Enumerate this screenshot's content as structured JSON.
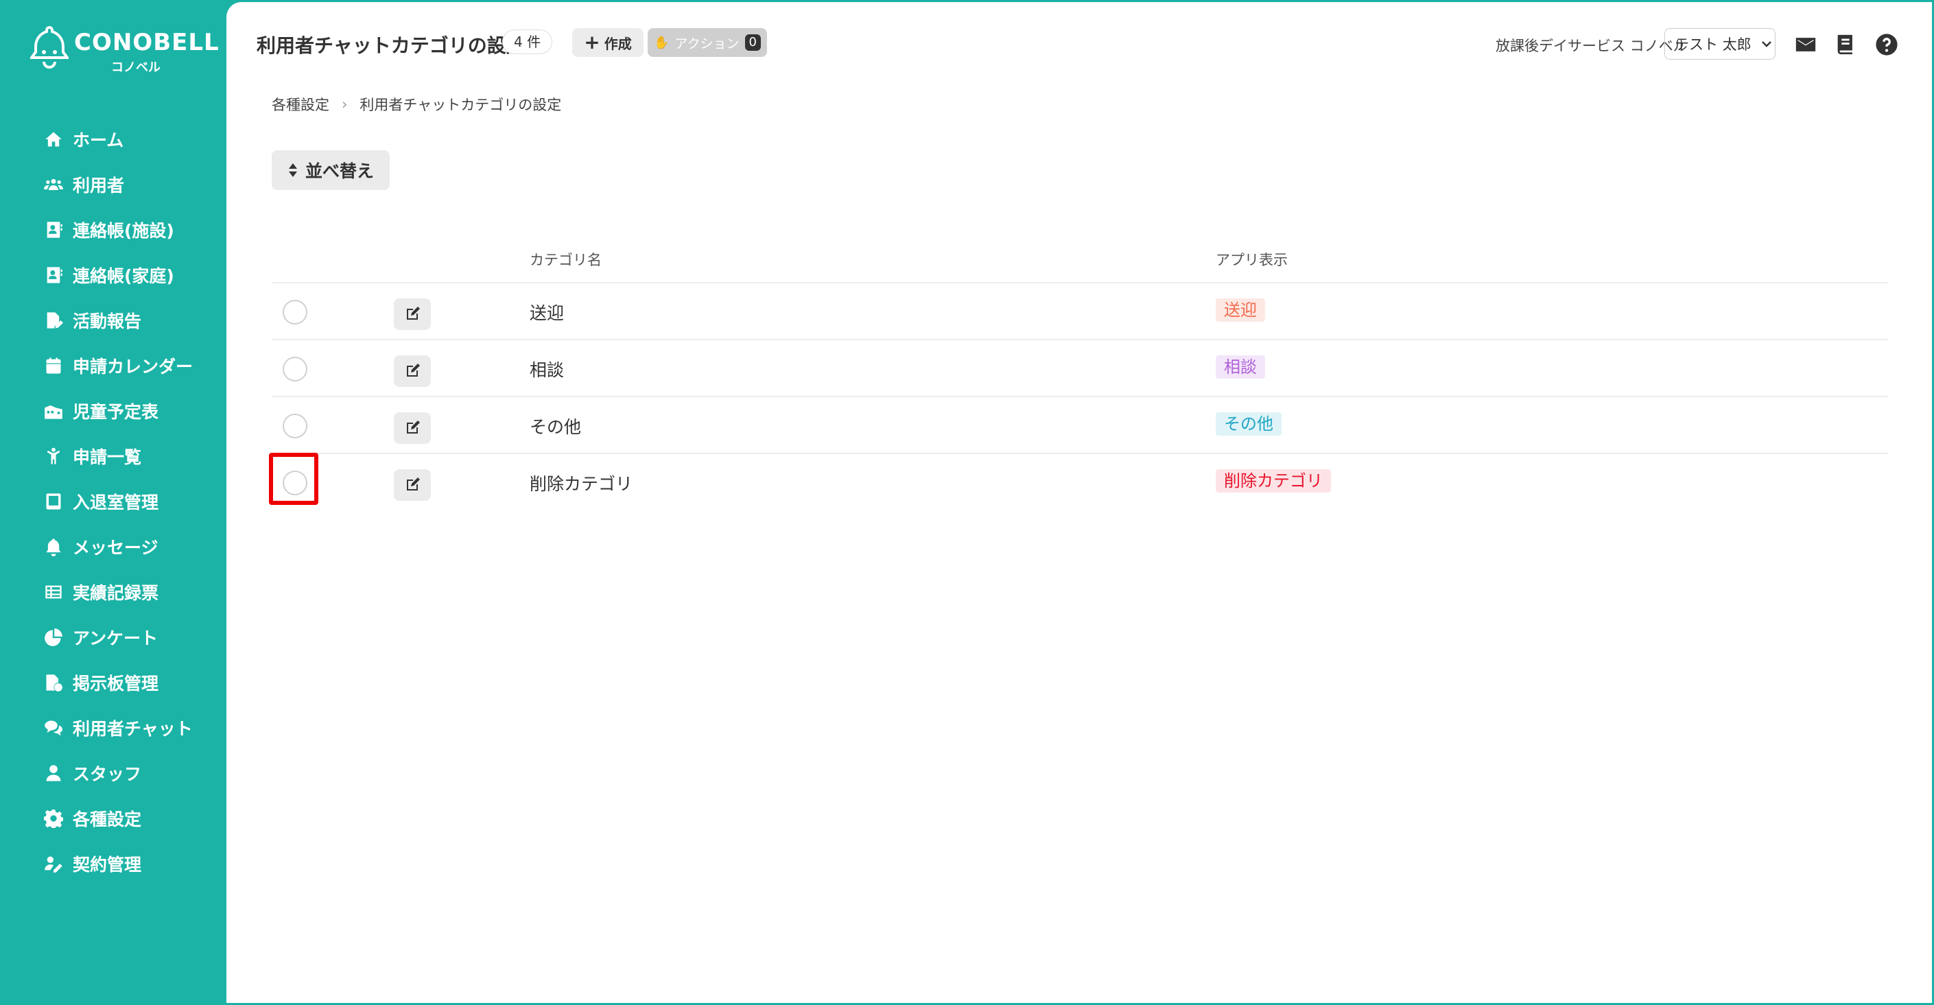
{
  "app": {
    "logo_text": "CONOBELL",
    "logo_sub": "コノベル"
  },
  "sidebar": {
    "items": [
      {
        "label": "ホーム",
        "icon": "home-icon"
      },
      {
        "label": "利用者",
        "icon": "users-icon"
      },
      {
        "label": "連絡帳(施設)",
        "icon": "contact-book-icon"
      },
      {
        "label": "連絡帳(家庭)",
        "icon": "contact-book-icon"
      },
      {
        "label": "活動報告",
        "icon": "report-icon"
      },
      {
        "label": "申請カレンダー",
        "icon": "calendar-icon"
      },
      {
        "label": "児童予定表",
        "icon": "schedule-icon"
      },
      {
        "label": "申請一覧",
        "icon": "child-icon"
      },
      {
        "label": "入退室管理",
        "icon": "tablet-icon"
      },
      {
        "label": "メッセージ",
        "icon": "bell-icon"
      },
      {
        "label": "実績記録票",
        "icon": "table-icon"
      },
      {
        "label": "アンケート",
        "icon": "pie-icon"
      },
      {
        "label": "掲示板管理",
        "icon": "board-icon"
      },
      {
        "label": "利用者チャット",
        "icon": "chat-icon"
      },
      {
        "label": "スタッフ",
        "icon": "staff-icon"
      },
      {
        "label": "各種設定",
        "icon": "gear-icon"
      },
      {
        "label": "契約管理",
        "icon": "contract-icon"
      }
    ]
  },
  "header": {
    "title": "利用者チャットカテゴリの設定",
    "count": "4 件",
    "create_label": "作成",
    "action_label": "アクション",
    "action_count": "0",
    "facility": "放課後デイサービス コノベル",
    "user": "テスト 太郎"
  },
  "breadcrumb": {
    "parent": "各種設定",
    "current": "利用者チャットカテゴリの設定"
  },
  "toolbar": {
    "sort_label": "並べ替え"
  },
  "table": {
    "columns": {
      "name": "カテゴリ名",
      "app": "アプリ表示"
    },
    "rows": [
      {
        "name": "送迎",
        "tag": "送迎",
        "tag_color": "#f26b4f",
        "tag_bg": "#fde8e3"
      },
      {
        "name": "相談",
        "tag": "相談",
        "tag_color": "#b061d6",
        "tag_bg": "#f3e6fa"
      },
      {
        "name": "その他",
        "tag": "その他",
        "tag_color": "#21a6c4",
        "tag_bg": "#dff3f8"
      },
      {
        "name": "削除カテゴリ",
        "tag": "削除カテゴリ",
        "tag_color": "#e8142c",
        "tag_bg": "#fde3e6"
      }
    ]
  },
  "colors": {
    "accent": "#1ab3a6",
    "highlight": "#ee0000"
  }
}
